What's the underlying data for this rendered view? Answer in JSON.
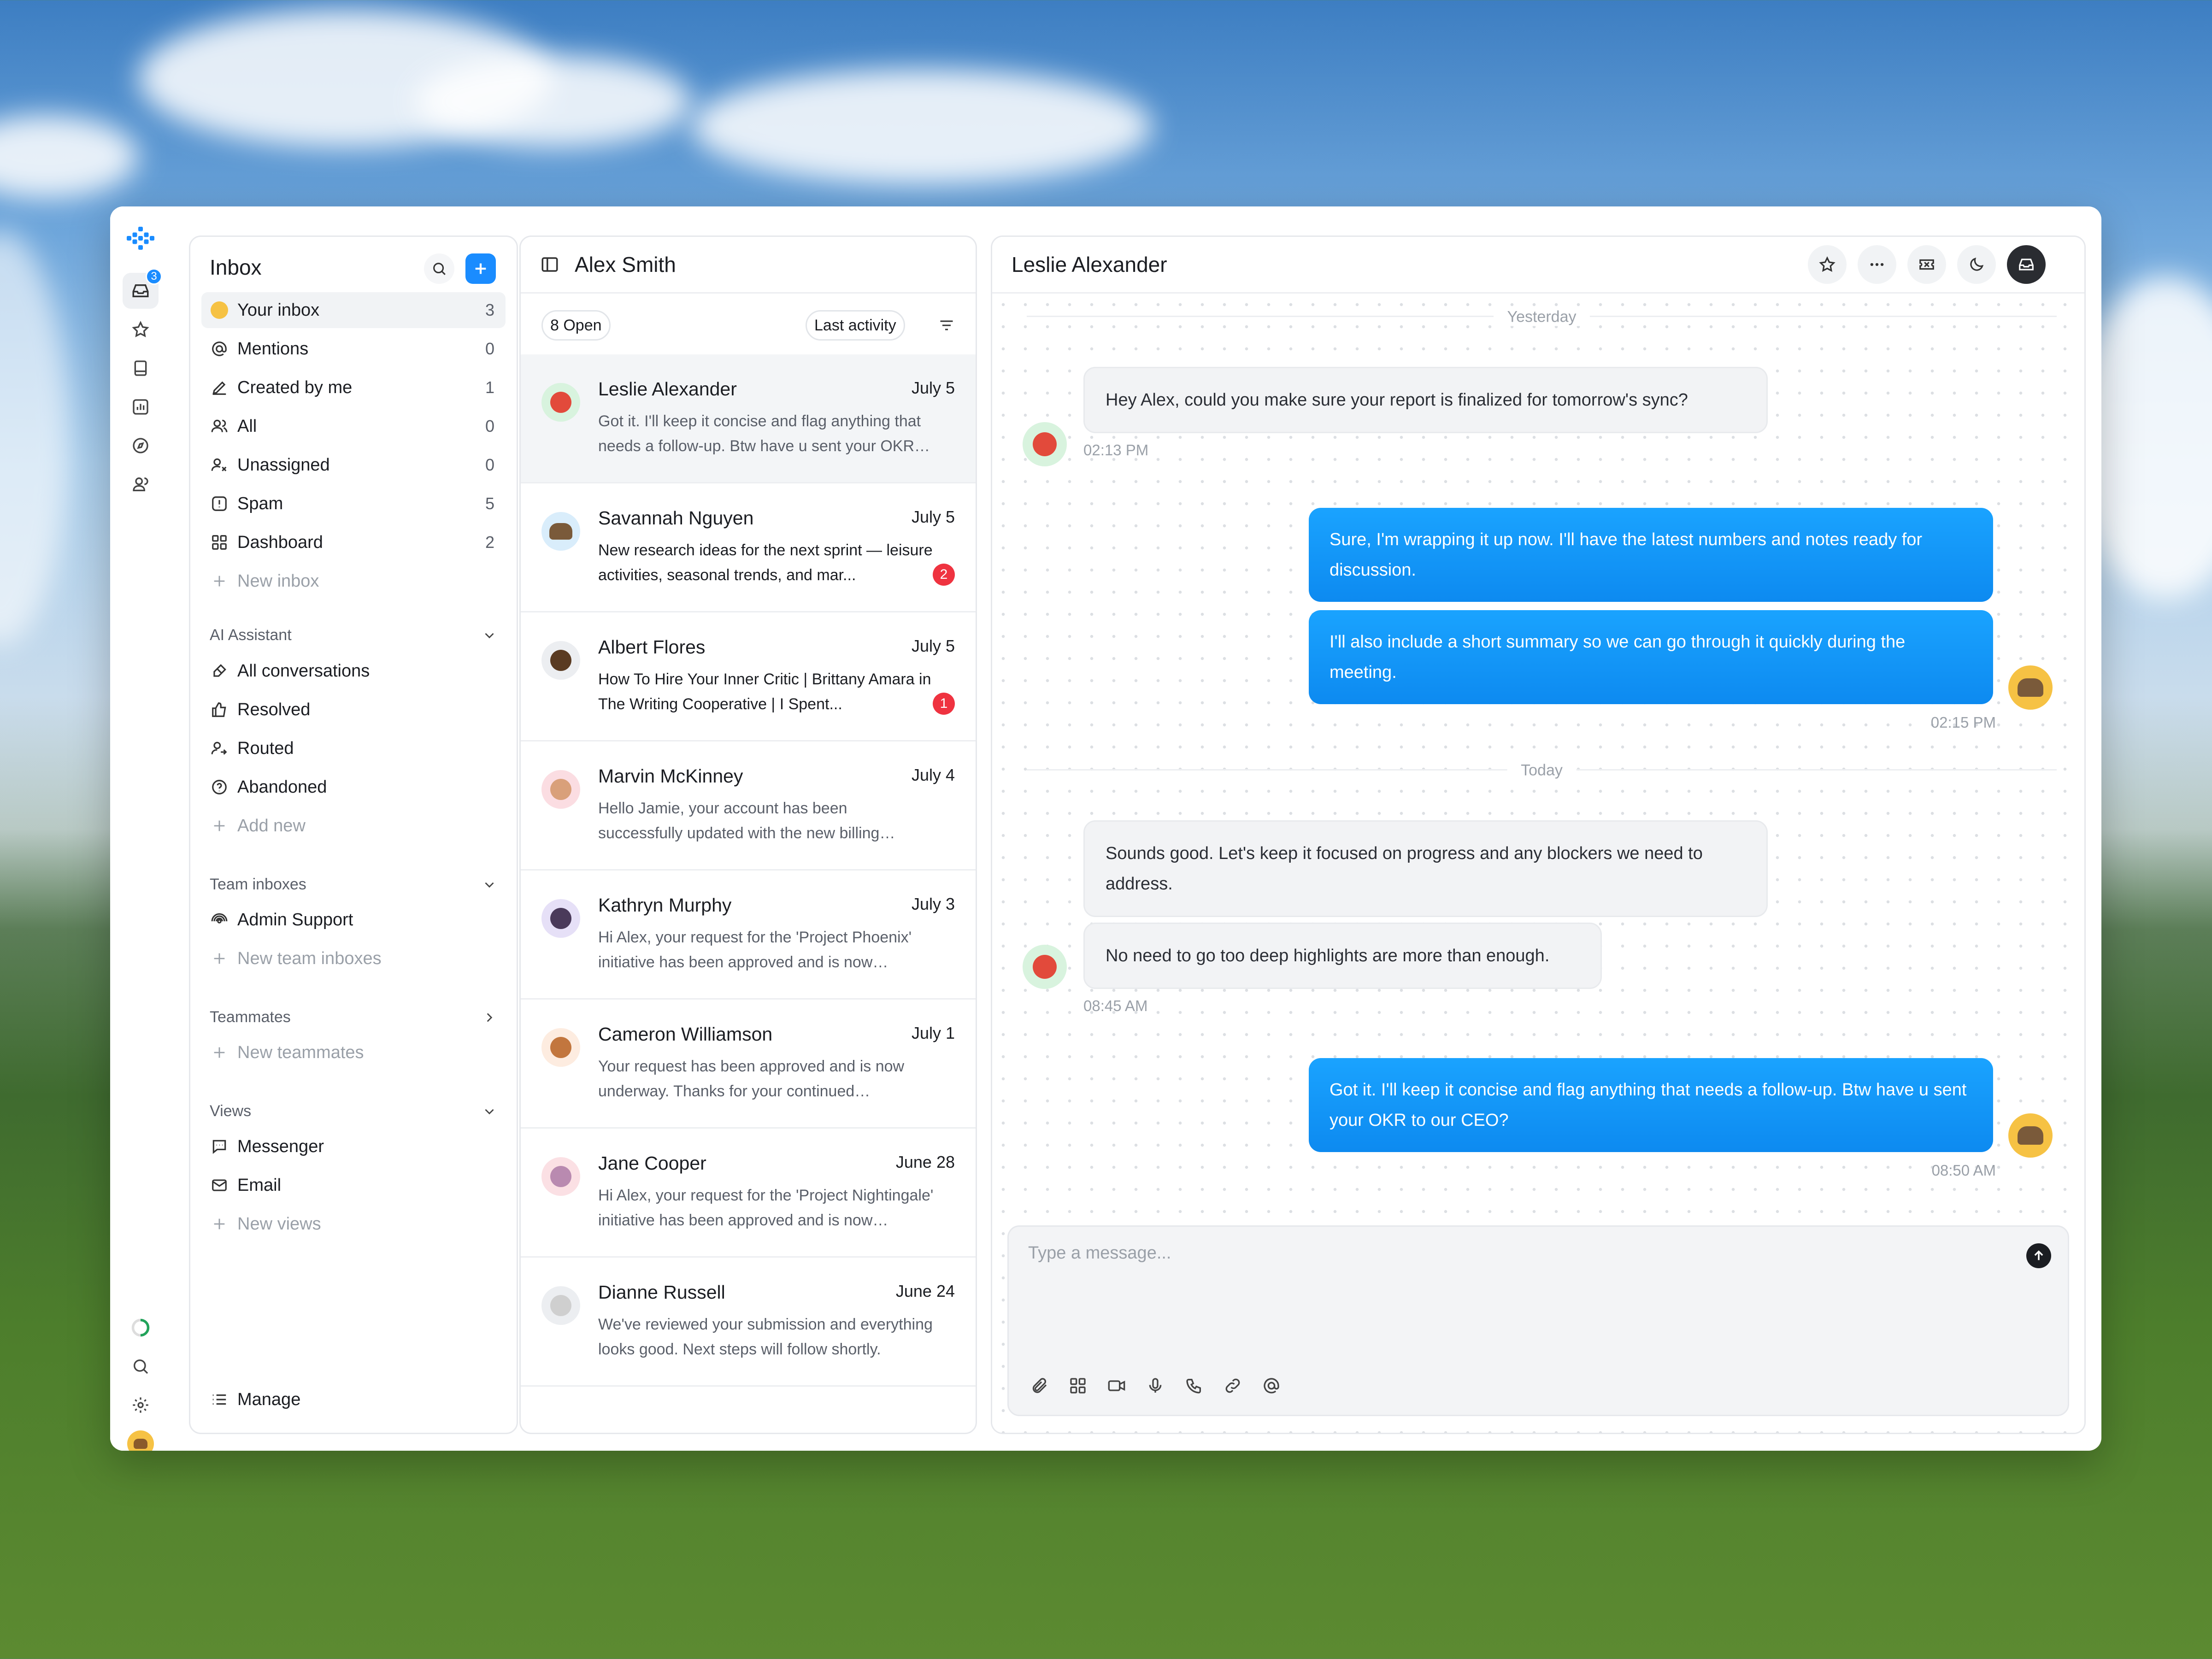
{
  "rail": {
    "inbox_badge": "3"
  },
  "sidebar": {
    "title": "Inbox",
    "items": [
      {
        "label": "Your inbox",
        "count": "3"
      },
      {
        "label": "Mentions",
        "count": "0"
      },
      {
        "label": "Created by me",
        "count": "1"
      },
      {
        "label": "All",
        "count": "0"
      },
      {
        "label": "Unassigned",
        "count": "0"
      },
      {
        "label": "Spam",
        "count": "5"
      },
      {
        "label": "Dashboard",
        "count": "2"
      }
    ],
    "new_inbox": "New inbox",
    "ai": {
      "title": "AI Assistant",
      "items": [
        "All conversations",
        "Resolved",
        "Routed",
        "Abandoned"
      ],
      "add": "Add new"
    },
    "team": {
      "title": "Team inboxes",
      "items": [
        "Admin Support"
      ],
      "add": "New team inboxes"
    },
    "teammates": {
      "title": "Teammates",
      "add": "New teammates"
    },
    "views": {
      "title": "Views",
      "items": [
        "Messenger",
        "Email"
      ],
      "add": "New views"
    },
    "manage": "Manage"
  },
  "list": {
    "title": "Alex Smith",
    "filter_open": "8 Open",
    "sort": "Last activity",
    "conversations": [
      {
        "name": "Leslie Alexander",
        "date": "July 5",
        "preview": "Got it. I'll keep it concise and flag anything that needs a follow-up. Btw have u sent your OKR to...",
        "unread": ""
      },
      {
        "name": "Savannah Nguyen",
        "date": "July 5",
        "preview": "New research ideas for the next sprint — leisure activities, seasonal trends, and mar...",
        "unread": "2"
      },
      {
        "name": "Albert Flores",
        "date": "July 5",
        "preview": "How To Hire Your Inner Critic | Brittany Amara in The Writing Cooperative | I Spent...",
        "unread": "1"
      },
      {
        "name": "Marvin McKinney",
        "date": "July 4",
        "preview": "Hello Jamie, your account has been successfully updated with the new billing information. Thank...",
        "unread": ""
      },
      {
        "name": "Kathryn Murphy",
        "date": "July 3",
        "preview": "Hi Alex, your request for the 'Project Phoenix' initiative has been approved and is now underw...",
        "unread": ""
      },
      {
        "name": "Cameron Williamson",
        "date": "July 1",
        "preview": "Your request has been approved and is now underway. Thanks for your continued collaborati...",
        "unread": ""
      },
      {
        "name": "Jane Cooper",
        "date": "June 28",
        "preview": "Hi Alex, your request for the 'Project Nightingale' initiative has been approved and is now underw...",
        "unread": ""
      },
      {
        "name": "Dianne Russell",
        "date": "June 24",
        "preview": "We've reviewed your submission and everything looks good. Next steps will follow shortly.",
        "unread": ""
      }
    ]
  },
  "chat": {
    "title": "Leslie Alexander",
    "day1": "Yesterday",
    "day2": "Today",
    "messages": [
      {
        "text": "Hey Alex, could you make sure your report is finalized for tomorrow's sync?",
        "time": "02:13 PM"
      },
      {
        "text": "Sure, I'm wrapping it up now. I'll have the latest numbers and notes ready for discussion."
      },
      {
        "text": "I'll also include a short summary so we can go through it quickly during the meeting.",
        "time": "02:15 PM"
      },
      {
        "text": "Sounds good. Let's keep it focused on progress and any blockers we need to address."
      },
      {
        "text": "No need to go too deep highlights are more than enough.",
        "time": "08:45 AM"
      },
      {
        "text": "Got it. I'll keep it concise and flag anything that needs a follow-up. Btw have u sent your OKR to our CEO?",
        "time": "08:50 AM"
      }
    ],
    "composer_placeholder": "Type a message..."
  }
}
